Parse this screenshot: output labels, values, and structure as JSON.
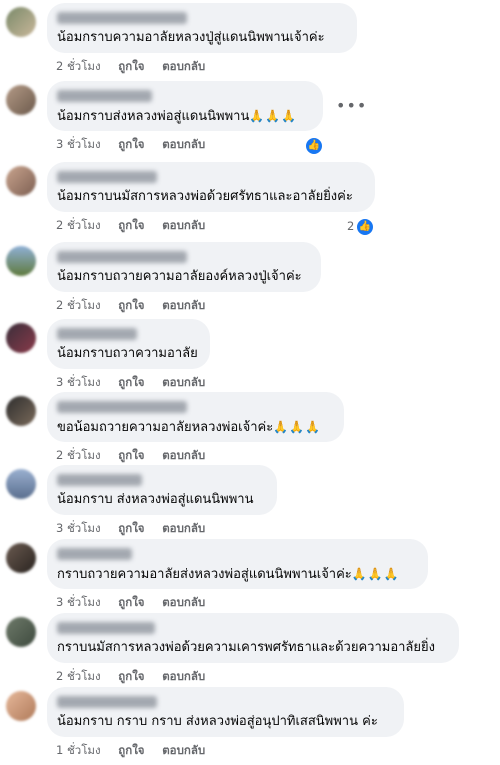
{
  "comments": [
    {
      "text": "น้อมกราบความอาลัยหลวงปู่สู่แดนนิพพานเจ้าค่ะ",
      "emoji": "",
      "time": "2 ชั่วโมง",
      "like": "ถูกใจ",
      "reply": "ตอบกลับ",
      "reactions": "",
      "reaction_icon": ""
    },
    {
      "text": "น้อมกราบส่งหลวงพ่อสู่แดนนิพพาน",
      "emoji": "🙏🙏🙏",
      "time": "3 ชั่วโมง",
      "like": "ถูกใจ",
      "reply": "ตอบกลับ",
      "reactions": "",
      "reaction_icon": "like-icon"
    },
    {
      "text": "น้อมกราบนมัสการหลวงพ่อด้วยศรัทธาและอาลัยยิ่งค่ะ",
      "emoji": "",
      "time": "2 ชั่วโมง",
      "like": "ถูกใจ",
      "reply": "ตอบกลับ",
      "reactions": "2",
      "reaction_icon": "like-icon"
    },
    {
      "text": "น้อมกราบถวายความอาลัยองค์หลวงปู่เจ้าค่ะ",
      "emoji": "",
      "time": "2 ชั่วโมง",
      "like": "ถูกใจ",
      "reply": "ตอบกลับ",
      "reactions": "",
      "reaction_icon": ""
    },
    {
      "text": "น้อมกราบถวาความอาลัย",
      "emoji": "",
      "time": "3 ชั่วโมง",
      "like": "ถูกใจ",
      "reply": "ตอบกลับ",
      "reactions": "",
      "reaction_icon": ""
    },
    {
      "text": "ขอน้อมถวายความอาลัยหลวงพ่อเจ้าค่ะ",
      "emoji": "🙏🙏🙏",
      "time": "2 ชั่วโมง",
      "like": "ถูกใจ",
      "reply": "ตอบกลับ",
      "reactions": "",
      "reaction_icon": ""
    },
    {
      "text": "น้อมกราบ ส่งหลวงพ่อสู่แดนนิพพาน",
      "emoji": "",
      "time": "3 ชั่วโมง",
      "like": "ถูกใจ",
      "reply": "ตอบกลับ",
      "reactions": "",
      "reaction_icon": ""
    },
    {
      "text": "กราบถวายความอาลัยส่งหลวงพ่อสู่แดนนิพพานเจ้าค่ะ",
      "emoji": "🙏🙏🙏",
      "time": "3 ชั่วโมง",
      "like": "ถูกใจ",
      "reply": "ตอบกลับ",
      "reactions": "",
      "reaction_icon": ""
    },
    {
      "text": "กราบนมัสการหลวงพ่อด้วยความเคารพศรัทธาและด้วยความอาลัยยิ่ง",
      "emoji": "",
      "time": "2 ชั่วโมง",
      "like": "ถูกใจ",
      "reply": "ตอบกลับ",
      "reactions": "",
      "reaction_icon": ""
    },
    {
      "text": "น้อมกราบ กราบ กราบ ส่งหลวงพ่อสู่อนุปาทิเสสนิพพาน ค่ะ",
      "emoji": "",
      "time": "1 ชั่วโมง",
      "like": "ถูกใจ",
      "reply": "ตอบกลับ",
      "reactions": "",
      "reaction_icon": ""
    }
  ],
  "more_options": "•••",
  "colors": {
    "bubble": "#f0f2f5",
    "meta": "#65676b",
    "like_blue": "#1877f2"
  }
}
